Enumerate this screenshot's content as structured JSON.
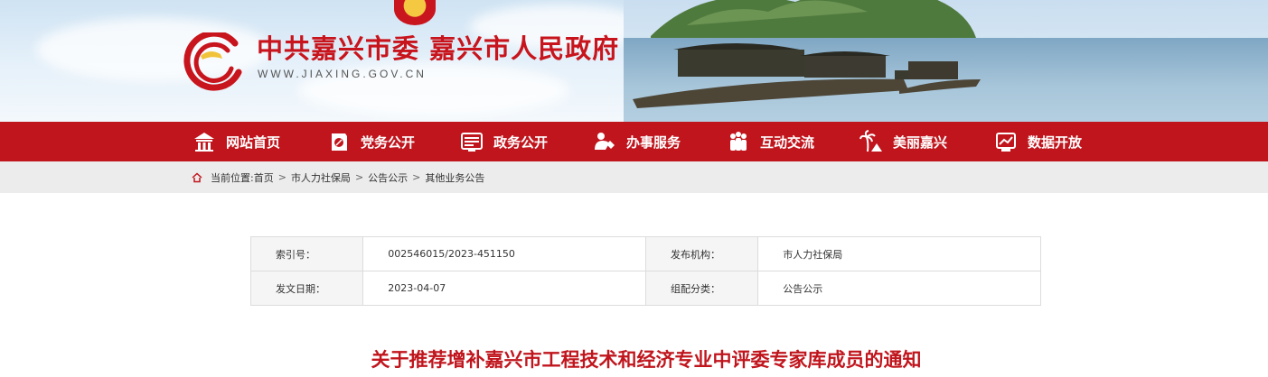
{
  "header": {
    "title": "中共嘉兴市委 嘉兴市人民政府",
    "url": "WWW.JIAXING.GOV.CN"
  },
  "nav": {
    "items": [
      {
        "label": "网站首页",
        "icon": "home-icon"
      },
      {
        "label": "党务公开",
        "icon": "party-icon"
      },
      {
        "label": "政务公开",
        "icon": "gov-affairs-icon"
      },
      {
        "label": "办事服务",
        "icon": "service-icon"
      },
      {
        "label": "互动交流",
        "icon": "interaction-icon"
      },
      {
        "label": "美丽嘉兴",
        "icon": "scenery-icon"
      },
      {
        "label": "数据开放",
        "icon": "data-icon"
      }
    ]
  },
  "breadcrumb": {
    "prefix": "当前位置:",
    "items": [
      "首页",
      "市人力社保局",
      "公告公示",
      "其他业务公告"
    ],
    "separator": ">"
  },
  "info": {
    "rows": [
      [
        {
          "label": "索引号：",
          "value": "002546015/2023-451150"
        },
        {
          "label": "发布机构：",
          "value": "市人力社保局"
        }
      ],
      [
        {
          "label": "发文日期：",
          "value": "2023-04-07"
        },
        {
          "label": "组配分类：",
          "value": "公告公示"
        }
      ]
    ]
  },
  "article": {
    "title": "关于推荐增补嘉兴市工程技术和经济专业中评委专家库成员的通知"
  },
  "colors": {
    "brand_red": "#c0151d",
    "crumb_bg": "#ececec"
  }
}
